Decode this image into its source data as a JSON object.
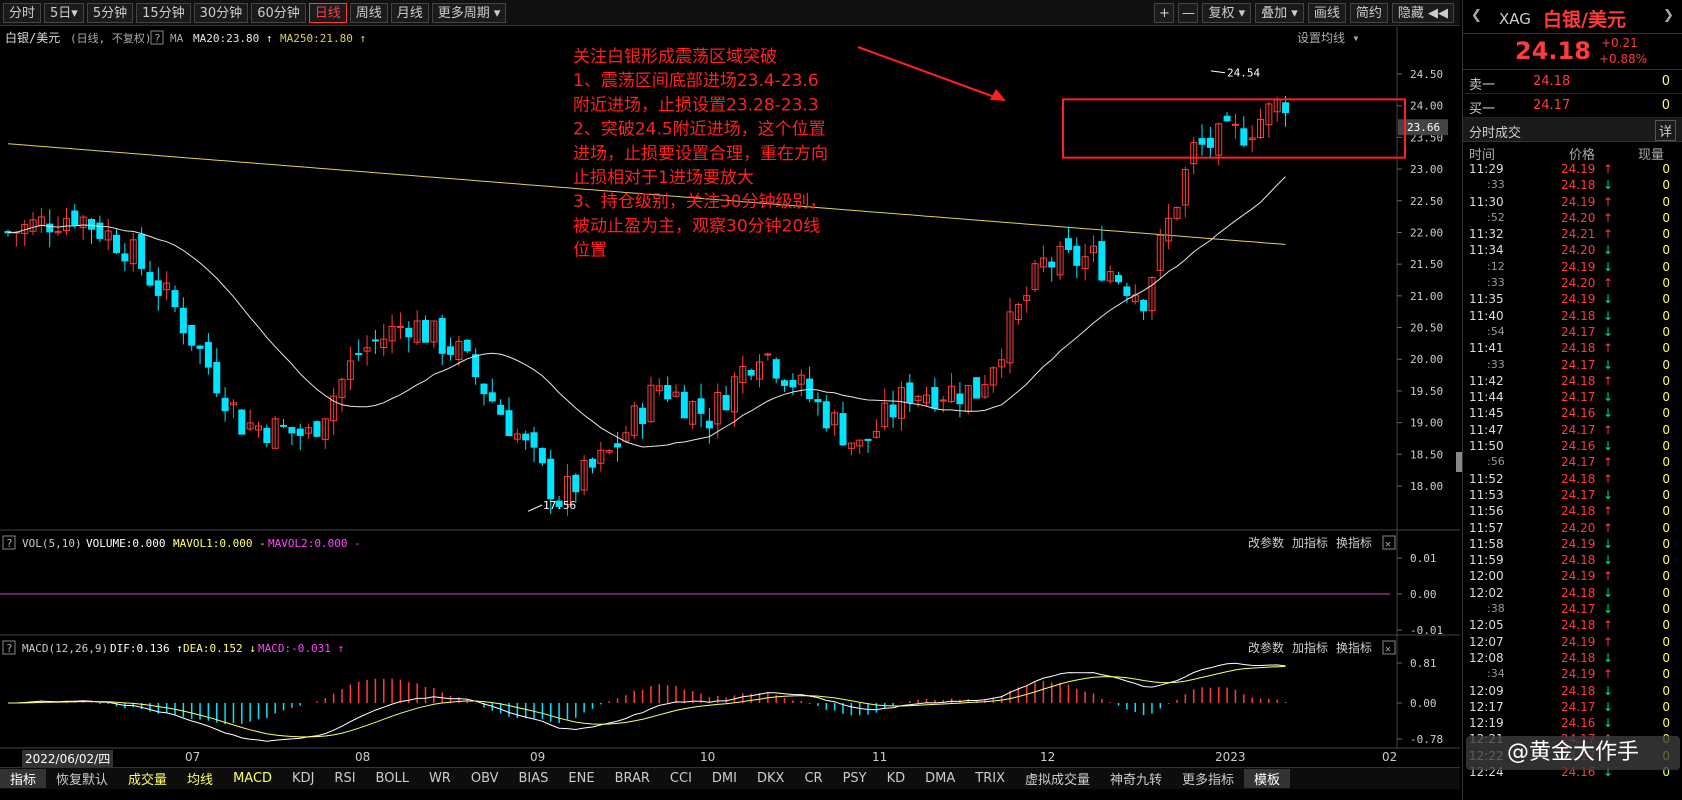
{
  "toolbar": {
    "periods": [
      "分时",
      "5日▾",
      "5分钟",
      "15分钟",
      "30分钟",
      "60分钟",
      "日线",
      "周线",
      "月线",
      "更多周期 ▾"
    ],
    "active": "日线",
    "right": [
      "+",
      "—",
      "复权 ▾",
      "叠加 ▾",
      "画线",
      "简约",
      "隐藏 ◀◀"
    ]
  },
  "legend": {
    "symbol": "白银/美元",
    "mode": "(日线, 不复权)",
    "help": "?",
    "ma": "MA",
    "ma20": "MA20:23.80 ↑",
    "ma250": "MA250:21.80 ↑",
    "setting": "设置均线 ▾"
  },
  "annotation": {
    "lines": [
      "关注白银形成震荡区域突破",
      "1、震荡区间底部进场23.4-23.6",
      "附近进场，止损设置23.28-23.3",
      "2、突破24.5附近进场，这个位置",
      "进场，止损要设置合理，重在方向",
      "止损相对于1进场要放大",
      "3、持仓级别，关注30分钟级别，",
      "被动止盈为主，观察30分钟20线",
      "位置"
    ]
  },
  "price_axis": [
    "24.50",
    "24.00",
    "23.50",
    "23.00",
    "22.50",
    "22.00",
    "21.50",
    "21.00",
    "20.50",
    "20.00",
    "19.50",
    "19.00",
    "18.50",
    "18.00"
  ],
  "current_price_tag": "23.66",
  "high_label": "24.54",
  "low_label": "17.56",
  "vol_panel": {
    "help": "?",
    "title": "VOL(5,10)",
    "volume": "VOLUME:0.000 -",
    "mavol1": "MAVOL1:0.000 -",
    "mavol2": "MAVOL2:0.000 -",
    "btn1": "改参数",
    "btn2": "加指标",
    "btn3": "换指标",
    "axis": [
      "0.01",
      "0.00",
      "-0.01"
    ]
  },
  "macd_panel": {
    "help": "?",
    "title": "MACD(12,26,9)",
    "dif": "DIF:0.136 ↑",
    "dea": "DEA:0.152 ↓",
    "macd": "MACD:-0.031 ↑",
    "btn1": "改参数",
    "btn2": "加指标",
    "btn3": "换指标",
    "axis": [
      "0.81",
      "0.00",
      "-0.78"
    ]
  },
  "date_axis": {
    "first": "2022/06/02/四",
    "labels": [
      "07",
      "08",
      "09",
      "10",
      "11",
      "12",
      "2023",
      "02"
    ]
  },
  "bottom_tabs": [
    "指标",
    "恢复默认",
    "成交量",
    "均线",
    "MACD",
    "KDJ",
    "RSI",
    "BOLL",
    "WR",
    "OBV",
    "BIAS",
    "ENE",
    "BRAR",
    "CCI",
    "DMI",
    "DKX",
    "CR",
    "PSY",
    "KD",
    "DMA",
    "TRIX",
    "虚拟成交量",
    "神奇九转",
    "更多指标",
    "模板"
  ],
  "quote": {
    "code": "XAG",
    "name": "白银/美元",
    "price": "24.18",
    "change": "+0.21",
    "pct": "+0.88%"
  },
  "order_book": [
    {
      "label": "卖一",
      "price": "24.18",
      "vol": "0"
    },
    {
      "label": "买一",
      "price": "24.17",
      "vol": "0"
    }
  ],
  "ticks_header": {
    "title": "分时成交",
    "detail": "详",
    "time": "时间",
    "price": "价格",
    "vol": "现量"
  },
  "ticks": [
    {
      "t": "11:29",
      "p": "24.19",
      "d": "↑",
      "v": "0"
    },
    {
      "t": ":33",
      "p": "24.18",
      "d": "↓",
      "v": "0"
    },
    {
      "t": "11:30",
      "p": "24.19",
      "d": "↑",
      "v": "0"
    },
    {
      "t": ":52",
      "p": "24.20",
      "d": "↑",
      "v": "0"
    },
    {
      "t": "11:32",
      "p": "24.21",
      "d": "↑",
      "v": "0"
    },
    {
      "t": "11:34",
      "p": "24.20",
      "d": "↓",
      "v": "0"
    },
    {
      "t": ":12",
      "p": "24.19",
      "d": "↓",
      "v": "0"
    },
    {
      "t": ":33",
      "p": "24.20",
      "d": "↑",
      "v": "0"
    },
    {
      "t": "11:35",
      "p": "24.19",
      "d": "↓",
      "v": "0"
    },
    {
      "t": "11:40",
      "p": "24.18",
      "d": "↓",
      "v": "0"
    },
    {
      "t": ":54",
      "p": "24.17",
      "d": "↓",
      "v": "0"
    },
    {
      "t": "11:41",
      "p": "24.18",
      "d": "↑",
      "v": "0"
    },
    {
      "t": ":33",
      "p": "24.17",
      "d": "↓",
      "v": "0"
    },
    {
      "t": "11:42",
      "p": "24.18",
      "d": "↑",
      "v": "0"
    },
    {
      "t": "11:44",
      "p": "24.17",
      "d": "↓",
      "v": "0"
    },
    {
      "t": "11:45",
      "p": "24.16",
      "d": "↓",
      "v": "0"
    },
    {
      "t": "11:47",
      "p": "24.17",
      "d": "↑",
      "v": "0"
    },
    {
      "t": "11:50",
      "p": "24.16",
      "d": "↓",
      "v": "0"
    },
    {
      "t": ":56",
      "p": "24.17",
      "d": "↑",
      "v": "0"
    },
    {
      "t": "11:52",
      "p": "24.18",
      "d": "↑",
      "v": "0"
    },
    {
      "t": "11:53",
      "p": "24.17",
      "d": "↓",
      "v": "0"
    },
    {
      "t": "11:56",
      "p": "24.18",
      "d": "↑",
      "v": "0"
    },
    {
      "t": "11:57",
      "p": "24.20",
      "d": "↑",
      "v": "0"
    },
    {
      "t": "11:58",
      "p": "24.19",
      "d": "↓",
      "v": "0"
    },
    {
      "t": "11:59",
      "p": "24.18",
      "d": "↓",
      "v": "0"
    },
    {
      "t": "12:00",
      "p": "24.19",
      "d": "↑",
      "v": "0"
    },
    {
      "t": "12:02",
      "p": "24.18",
      "d": "↓",
      "v": "0"
    },
    {
      "t": ":38",
      "p": "24.17",
      "d": "↓",
      "v": "0"
    },
    {
      "t": "12:05",
      "p": "24.18",
      "d": "↑",
      "v": "0"
    },
    {
      "t": "12:07",
      "p": "24.19",
      "d": "↑",
      "v": "0"
    },
    {
      "t": "12:08",
      "p": "24.18",
      "d": "↓",
      "v": "0"
    },
    {
      "t": ":34",
      "p": "24.19",
      "d": "↑",
      "v": "0"
    },
    {
      "t": "12:09",
      "p": "24.18",
      "d": "↓",
      "v": "0"
    },
    {
      "t": "12:17",
      "p": "24.17",
      "d": "↓",
      "v": "0"
    },
    {
      "t": "12:19",
      "p": "24.16",
      "d": "↓",
      "v": "0"
    },
    {
      "t": "12:21",
      "p": "24.17",
      "d": "↑",
      "v": "0"
    },
    {
      "t": "12:22",
      "p": "24.17",
      "d": "↑",
      "v": "0"
    },
    {
      "t": "12:24",
      "p": "24.16",
      "d": "↓",
      "v": "0"
    }
  ],
  "watermark": "@黄金大作手",
  "colors": {
    "up": "#ff3b3b",
    "down": "#00e5ff",
    "ma20": "#e6e6e6",
    "ma250": "#e0d060",
    "box": "#ff2020",
    "annotation": "#ff2020"
  }
}
